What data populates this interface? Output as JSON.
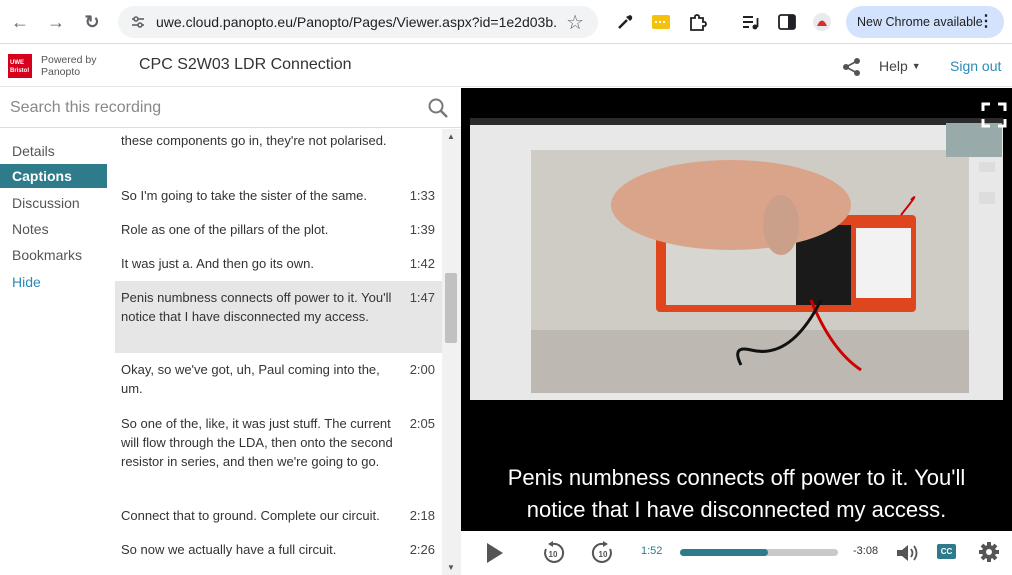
{
  "browser": {
    "url": "uwe.cloud.panopto.eu/Panopto/Pages/Viewer.aspx?id=1e2d03b...",
    "new_chrome": "New Chrome available"
  },
  "header": {
    "powered_line1": "Powered by",
    "powered_line2": "Panopto",
    "title": "CPC S2W03 LDR Connection",
    "help": "Help",
    "signout": "Sign out",
    "logo_text": "UWE Bristol"
  },
  "search": {
    "placeholder": "Search this recording"
  },
  "nav": {
    "items": [
      "Details",
      "Captions",
      "Discussion",
      "Notes",
      "Bookmarks"
    ],
    "hide": "Hide",
    "active": "Captions"
  },
  "captions": [
    {
      "text": "these components go in, they're not polarised.",
      "time": ""
    },
    {
      "text": "So I'm going to take the sister of the same.",
      "time": "1:33"
    },
    {
      "text": "Role as one of the pillars of the plot.",
      "time": "1:39"
    },
    {
      "text": "It was just a. And then go its own.",
      "time": "1:42"
    },
    {
      "text": "Penis numbness connects off power to it. You'll notice that I have disconnected my access.",
      "time": "1:47"
    },
    {
      "text": "Okay, so we've got, uh, Paul coming into the, um.",
      "time": "2:00"
    },
    {
      "text": "So one of the, like, it was just stuff. The current will flow through the LDA, then onto the second resistor in series, and then we're going to go.",
      "time": "2:05"
    },
    {
      "text": "Connect that to ground. Complete our circuit.",
      "time": "2:18"
    },
    {
      "text": "So now we actually have a full circuit.",
      "time": "2:26"
    }
  ],
  "video": {
    "subtitle_line1": "Penis numbness connects off power to it. You'll",
    "subtitle_line2": "notice that I have disconnected my access."
  },
  "player": {
    "current_time": "1:52",
    "remaining_time": "-3:08",
    "progress": 0.56,
    "cc_label": "CC",
    "skip_back": "10",
    "skip_forward": "10"
  }
}
